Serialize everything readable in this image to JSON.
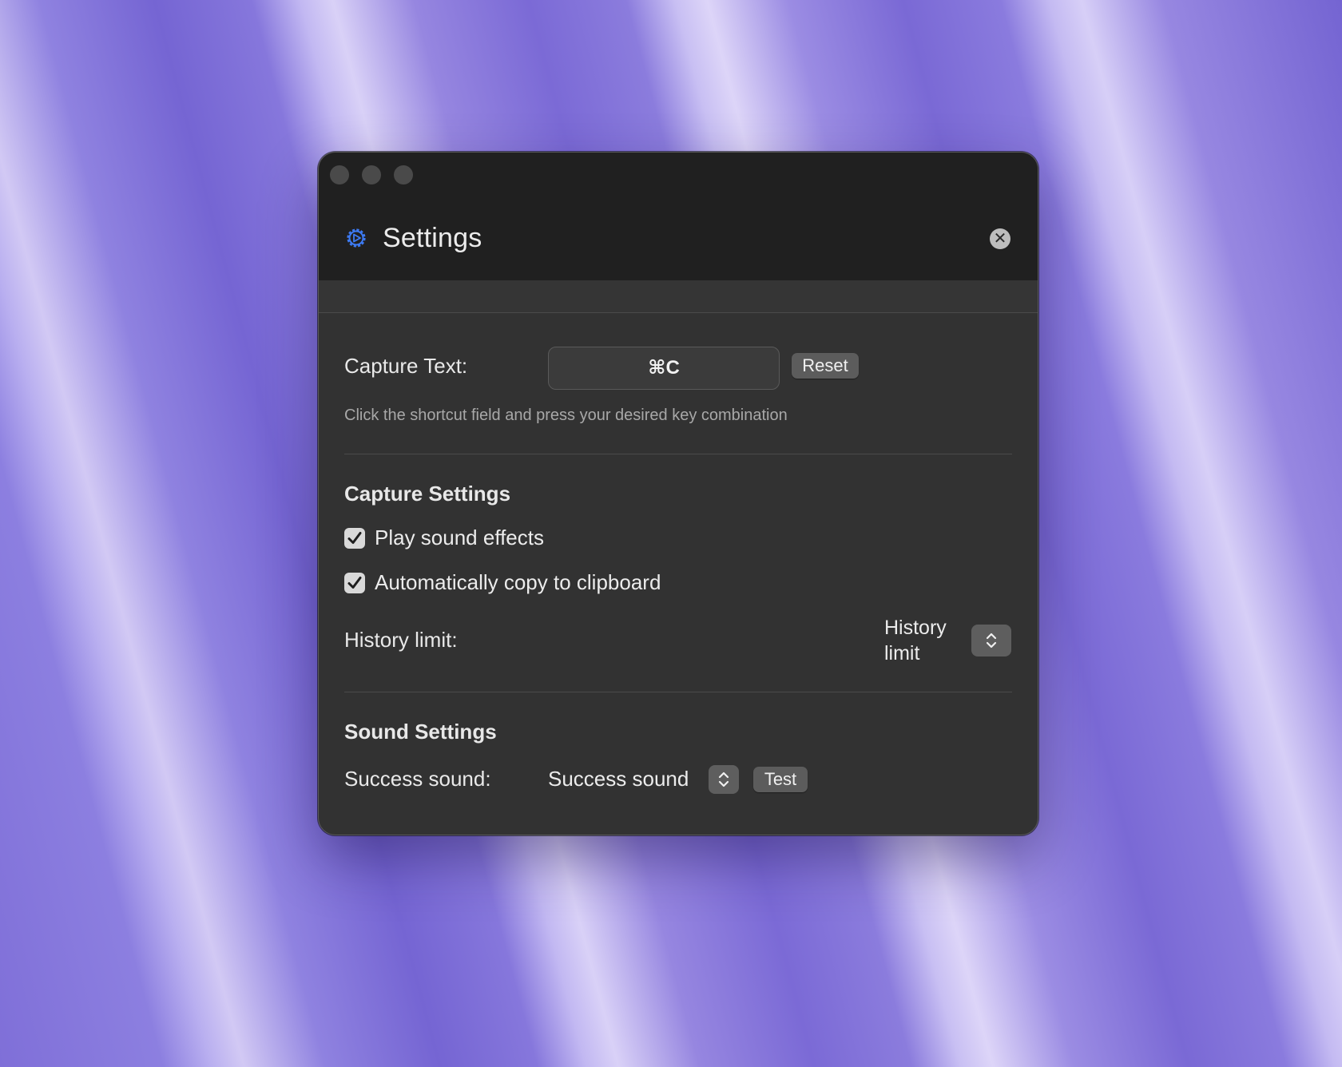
{
  "window": {
    "title": "Settings",
    "close_glyph": "✕"
  },
  "capture_text": {
    "label": "Capture Text:",
    "shortcut": "⌘C",
    "reset_label": "Reset",
    "hint": "Click the shortcut field and press your desired key combination"
  },
  "capture_settings": {
    "title": "Capture Settings",
    "play_sound": {
      "label": "Play sound effects",
      "checked": true
    },
    "auto_copy": {
      "label": "Automatically copy to clipboard",
      "checked": true
    },
    "history_limit": {
      "label": "History limit:",
      "value_line1": "History",
      "value_line2": "limit"
    }
  },
  "sound_settings": {
    "title": "Sound Settings",
    "success_sound": {
      "label": "Success sound:",
      "value": "Success sound",
      "test_label": "Test"
    }
  },
  "icons": {
    "app": "gear-icon",
    "close": "close-icon",
    "check": "checkmark-icon",
    "stepper": "chevron-up-down-icon"
  },
  "colors": {
    "accent": "#3d7bf5",
    "window_bg": "#323232",
    "header_bg": "#202020"
  }
}
